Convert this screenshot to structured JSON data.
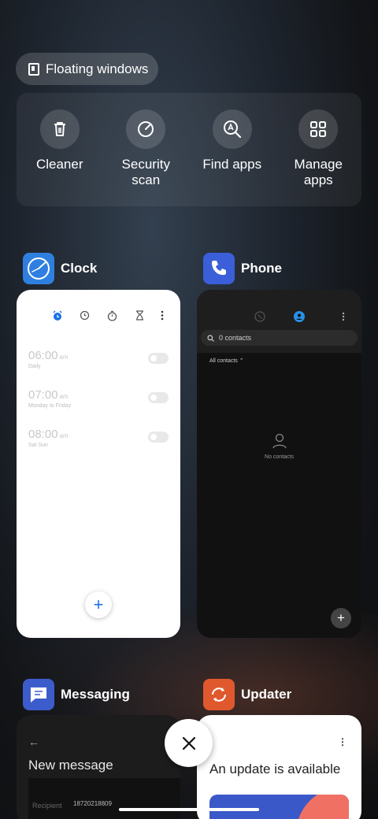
{
  "floating_windows": {
    "label": "Floating windows"
  },
  "tools": [
    {
      "label": "Cleaner",
      "icon": "trash-icon"
    },
    {
      "label": "Security scan",
      "icon": "security-scan-icon"
    },
    {
      "label": "Find apps",
      "icon": "find-apps-icon"
    },
    {
      "label": "Manage apps",
      "icon": "grid-icon"
    }
  ],
  "apps": {
    "clock": {
      "name": "Clock",
      "alarms": [
        {
          "time": "06:00",
          "ampm": "am",
          "repeat": "Daily"
        },
        {
          "time": "07:00",
          "ampm": "am",
          "repeat": "Monday to Friday"
        },
        {
          "time": "08:00",
          "ampm": "am",
          "repeat": "Sat Sun"
        }
      ],
      "fab": "+"
    },
    "phone": {
      "name": "Phone",
      "search_placeholder": "0 contacts",
      "filter": "All contacts",
      "empty": "No contacts",
      "fab": "+"
    },
    "messaging": {
      "name": "Messaging",
      "back": "←",
      "title": "New message",
      "recipient": "Recipient",
      "number": "18720218809"
    },
    "updater": {
      "name": "Updater",
      "title": "An update is available",
      "menu": "⋮"
    }
  },
  "colors": {
    "accent_blue": "#1a73e8",
    "phone_icon": "#3b5fd9",
    "updater_icon": "#e0582d",
    "messaging_icon": "#3d5ccc",
    "clock_icon": "#2f7fe0"
  }
}
